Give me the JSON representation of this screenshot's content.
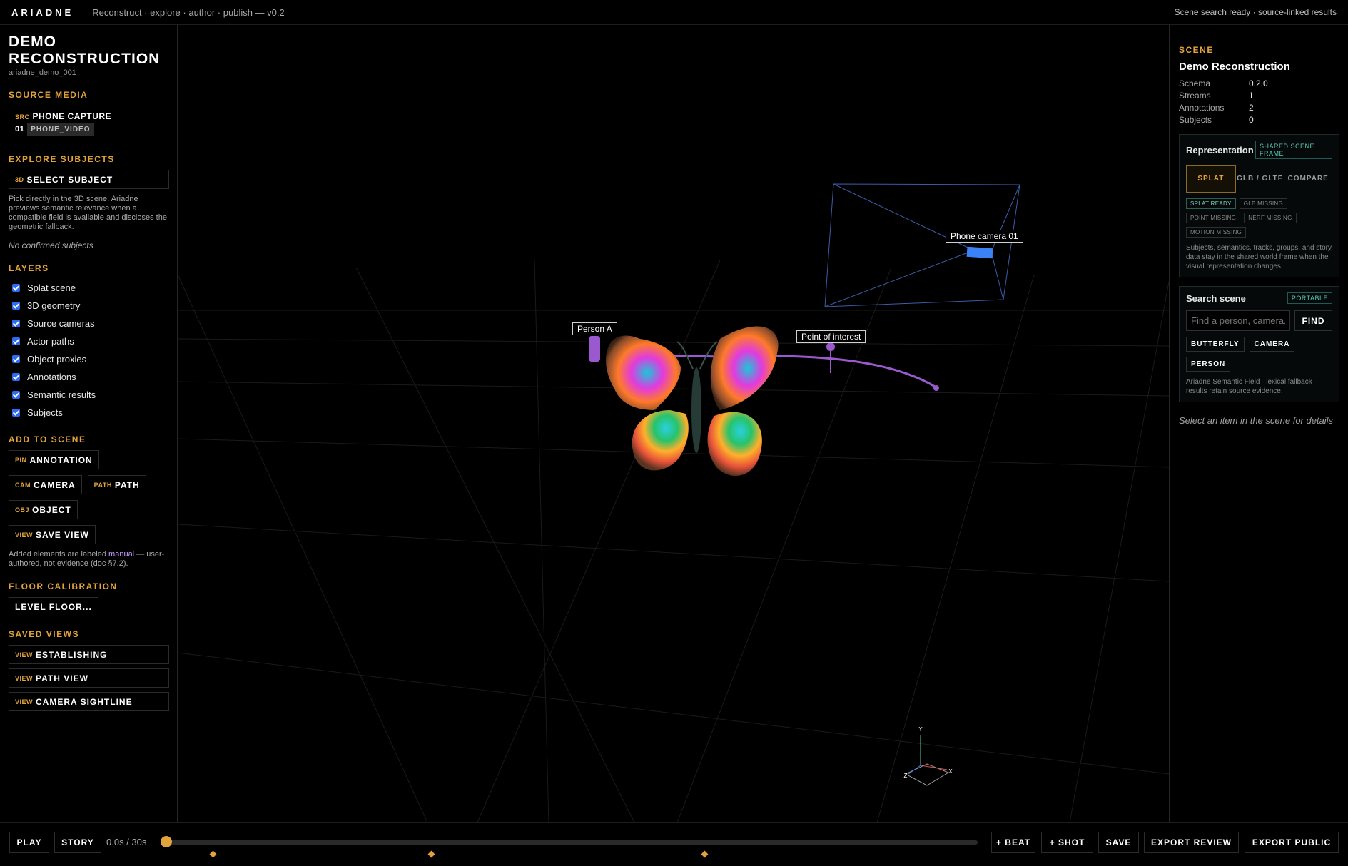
{
  "app": {
    "brand": "ARIADNE",
    "tagline": "Reconstruct · explore · author · publish — v0.2",
    "status": "Scene search ready · source-linked results"
  },
  "left": {
    "title": "DEMO RECONSTRUCTION",
    "id": "ariadne_demo_001",
    "source_media": {
      "heading": "SOURCE MEDIA",
      "kw": "SRC",
      "label": "PHONE CAPTURE",
      "index": "01",
      "tag": "PHONE_VIDEO"
    },
    "explore": {
      "heading": "EXPLORE SUBJECTS",
      "kw": "3D",
      "button": "SELECT SUBJECT",
      "description": "Pick directly in the 3D scene. Ariadne previews semantic relevance when a compatible field is available and discloses the geometric fallback.",
      "empty": "No confirmed subjects"
    },
    "layers": {
      "heading": "LAYERS",
      "items": [
        "Splat scene",
        "3D geometry",
        "Source cameras",
        "Actor paths",
        "Object proxies",
        "Annotations",
        "Semantic results",
        "Subjects"
      ]
    },
    "add": {
      "heading": "ADD TO SCENE",
      "pin_kw": "PIN",
      "pin": "ANNOTATION",
      "cam_kw": "CAM",
      "cam": "CAMERA",
      "path_kw": "PATH",
      "path": "PATH",
      "obj_kw": "OBJ",
      "obj": "OBJECT",
      "view_kw": "VIEW",
      "view": "SAVE VIEW",
      "note_pre": "Added elements are labeled ",
      "note_manual": "manual",
      "note_post": " — user-authored, not evidence (doc §7.2)."
    },
    "floor": {
      "heading": "FLOOR CALIBRATION",
      "button": "LEVEL FLOOR..."
    },
    "saved": {
      "heading": "SAVED VIEWS",
      "kw": "VIEW",
      "items": [
        "ESTABLISHING",
        "PATH VIEW",
        "CAMERA SIGHTLINE"
      ]
    }
  },
  "viewport": {
    "labels": {
      "person": "Person A",
      "poi": "Point of interest",
      "camera": "Phone camera 01"
    },
    "gizmo": {
      "y": "Y",
      "x": "X",
      "z": "Z"
    }
  },
  "right": {
    "heading": "SCENE",
    "title": "Demo Reconstruction",
    "meta": [
      {
        "k": "Schema",
        "v": "0.2.0"
      },
      {
        "k": "Streams",
        "v": "1"
      },
      {
        "k": "Annotations",
        "v": "2"
      },
      {
        "k": "Subjects",
        "v": "0"
      }
    ],
    "representation": {
      "title": "Representation",
      "badge": "SHARED SCENE FRAME",
      "tabs": [
        "SPLAT",
        "GLB / GLTF",
        "COMPARE"
      ],
      "status": [
        "SPLAT READY",
        "GLB MISSING",
        "POINT MISSING",
        "NERF MISSING",
        "MOTION MISSING"
      ],
      "note": "Subjects, semantics, tracks, groups, and story data stay in the shared world frame when the visual representation changes."
    },
    "search": {
      "title": "Search scene",
      "badge": "PORTABLE",
      "placeholder": "Find a person, camera, object",
      "find": "FIND",
      "chips": [
        "BUTTERFLY",
        "CAMERA",
        "PERSON"
      ],
      "note": "Ariadne Semantic Field · lexical fallback · results retain source evidence."
    },
    "hint": "Select an item in the scene for details"
  },
  "bottom": {
    "play": "PLAY",
    "story": "STORY",
    "time": "0.0s / 30s",
    "beat": "+ BEAT",
    "shot": "+ SHOT",
    "save": "SAVE",
    "export_review": "EXPORT REVIEW",
    "export_public": "EXPORT PUBLIC",
    "playhead": 0
  },
  "colors": {
    "accent": "#e3a33c",
    "path": "#9b59d0",
    "teal": "#58c7b5",
    "camera": "#3b82f6"
  }
}
